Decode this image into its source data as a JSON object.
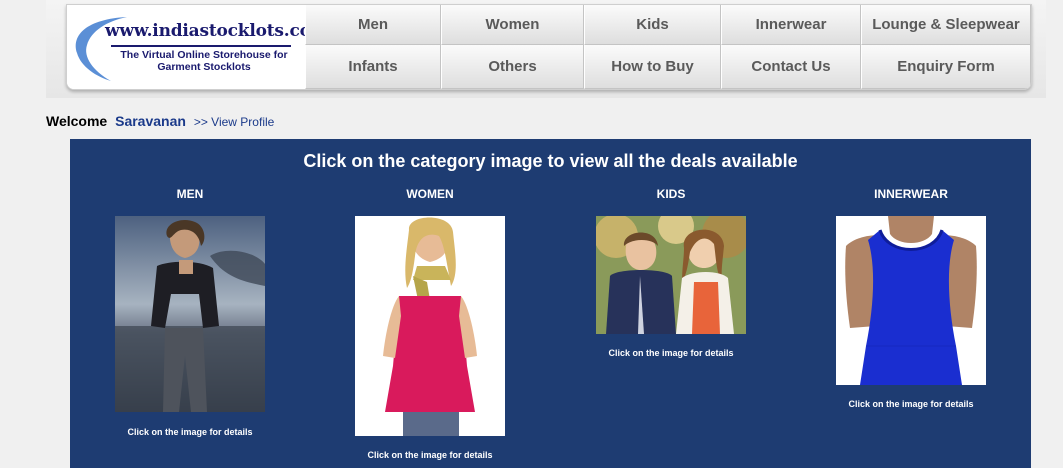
{
  "logo": {
    "domain": "www.indiastocklots.com",
    "tagline": "The Virtual Online Storehouse for Garment Stocklots"
  },
  "nav": {
    "row1": [
      "Men",
      "Women",
      "Kids",
      "Innerwear",
      "Lounge & Sleepwear"
    ],
    "row2": [
      "Infants",
      "Others",
      "How to Buy",
      "Contact Us",
      "Enquiry Form"
    ]
  },
  "welcome": {
    "label": "Welcome",
    "user": "Saravanan",
    "profile_link": ">> View Profile"
  },
  "panel": {
    "title": "Click on the category image to view all the deals available",
    "categories": [
      {
        "label": "MEN",
        "note": "Click on the image for details"
      },
      {
        "label": "WOMEN",
        "note": "Click on the image for details"
      },
      {
        "label": "KIDS",
        "note": "Click on the image for details"
      },
      {
        "label": "INNERWEAR",
        "note": "Click on the image for details"
      }
    ]
  },
  "colors": {
    "panel_bg": "#1e3c72",
    "logo_text": "#1a1a6e",
    "logo_swoosh": "#5b8fd6",
    "nav_text": "#5a5a5a",
    "link": "#1b3a8a"
  }
}
